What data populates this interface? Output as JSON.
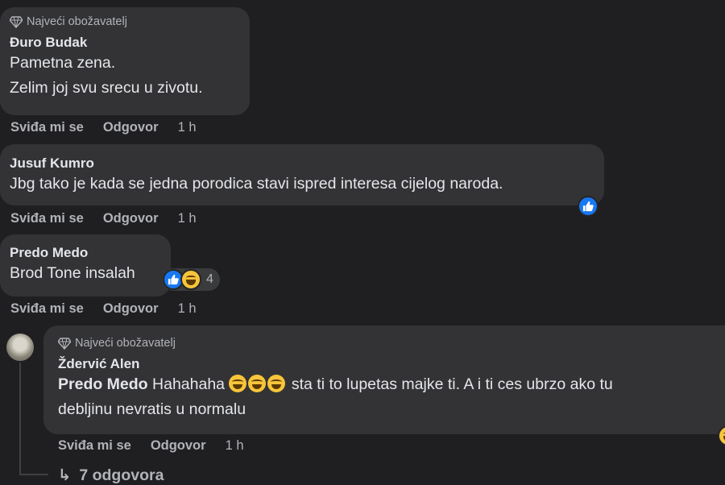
{
  "comments": [
    {
      "badge": "Najveći obožavatelj",
      "author": "Đuro Budak",
      "lines": [
        "Pametna zena.",
        "Zelim joj svu srecu u zivotu."
      ],
      "like_label": "Sviđa mi se",
      "reply_label": "Odgovor",
      "time": "1 h"
    },
    {
      "author": "Jusuf Kumro",
      "lines": [
        "Jbg tako je kada se jedna porodica stavi ispred interesa cijelog naroda."
      ],
      "like_label": "Sviđa mi se",
      "reply_label": "Odgovor",
      "time": "1 h",
      "reactions": [
        "like"
      ]
    },
    {
      "author": "Predo Medo",
      "lines": [
        "Brod Tone insalah"
      ],
      "like_label": "Sviđa mi se",
      "reply_label": "Odgovor",
      "time": "1 h",
      "reactions": [
        "like",
        "haha"
      ],
      "reaction_count": "4"
    }
  ],
  "reply": {
    "badge": "Najveći obožavatelj",
    "author": "Ždervić Alen",
    "mention": "Predo Medo",
    "text_before_emoji": "Hahahaha",
    "text_after_emoji": "sta ti to lupetas majke ti. A i ti ces ubrzo ako tu",
    "text_line2": "debljinu nevratis u normalu",
    "like_label": "Sviđa mi se",
    "reply_label": "Odgovor",
    "time": "1 h"
  },
  "more_replies": {
    "arrow": "↳",
    "label": "7 odgovora"
  },
  "colors": {
    "background": "#1f1f21",
    "bubble": "#333335",
    "like_blue": "#1877f2",
    "muted_text": "#b0b3b8"
  }
}
